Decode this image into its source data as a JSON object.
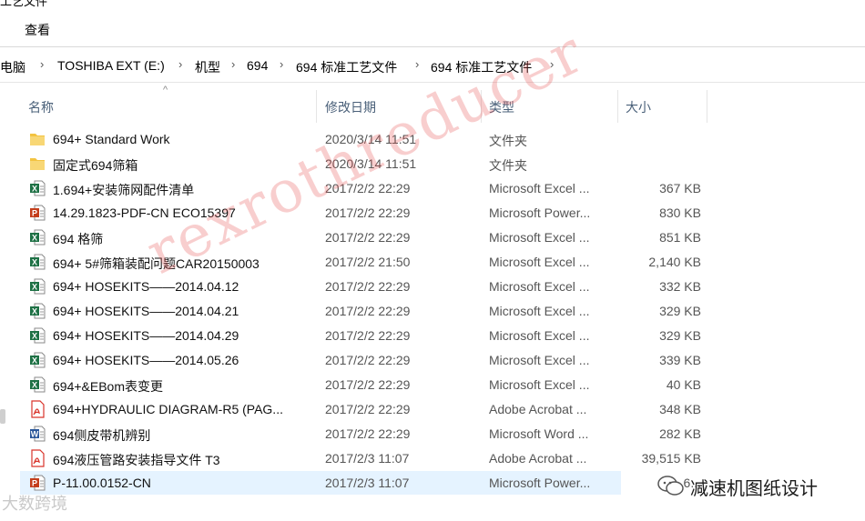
{
  "window": {
    "title_fragment": "工艺文件"
  },
  "ribbon": {
    "view_tab": "查看"
  },
  "address_bar": {
    "crumbs": [
      "此电脑",
      "TOSHIBA EXT (E:)",
      "机型",
      "694",
      "694 标准工艺文件",
      "694 标准工艺文件"
    ],
    "separator_icon": "chevron-right-icon"
  },
  "columns": {
    "name": "名称",
    "date": "修改日期",
    "type": "类型",
    "size": "大小"
  },
  "files": [
    {
      "name": "694+ Standard Work",
      "date": "2020/3/14 11:51",
      "type": "文件夹",
      "size": "",
      "icon": "folder-icon"
    },
    {
      "name": "固定式694筛箱",
      "date": "2020/3/14 11:51",
      "type": "文件夹",
      "size": "",
      "icon": "folder-icon"
    },
    {
      "name": "1.694+安装筛网配件清单",
      "date": "2017/2/2 22:29",
      "type": "Microsoft Excel ...",
      "size": "367 KB",
      "icon": "excel-icon"
    },
    {
      "name": "14.29.1823-PDF-CN ECO15397",
      "date": "2017/2/2 22:29",
      "type": "Microsoft Power...",
      "size": "830 KB",
      "icon": "powerpoint-icon"
    },
    {
      "name": "694 格筛",
      "date": "2017/2/2 22:29",
      "type": "Microsoft Excel ...",
      "size": "851 KB",
      "icon": "excel-icon"
    },
    {
      "name": "694+ 5#筛箱装配问题CAR20150003",
      "date": "2017/2/2 21:50",
      "type": "Microsoft Excel ...",
      "size": "2,140 KB",
      "icon": "excel-icon"
    },
    {
      "name": "694+ HOSEKITS——2014.04.12",
      "date": "2017/2/2 22:29",
      "type": "Microsoft Excel ...",
      "size": "332 KB",
      "icon": "excel-icon"
    },
    {
      "name": "694+ HOSEKITS——2014.04.21",
      "date": "2017/2/2 22:29",
      "type": "Microsoft Excel ...",
      "size": "329 KB",
      "icon": "excel-icon"
    },
    {
      "name": "694+ HOSEKITS——2014.04.29",
      "date": "2017/2/2 22:29",
      "type": "Microsoft Excel ...",
      "size": "329 KB",
      "icon": "excel-icon"
    },
    {
      "name": "694+ HOSEKITS——2014.05.26",
      "date": "2017/2/2 22:29",
      "type": "Microsoft Excel ...",
      "size": "339 KB",
      "icon": "excel-icon"
    },
    {
      "name": "694+&EBom表变更",
      "date": "2017/2/2 22:29",
      "type": "Microsoft Excel ...",
      "size": "40 KB",
      "icon": "excel-icon"
    },
    {
      "name": "694+HYDRAULIC DIAGRAM-R5 (PAG...",
      "date": "2017/2/2 22:29",
      "type": "Adobe Acrobat ...",
      "size": "348 KB",
      "icon": "pdf-icon"
    },
    {
      "name": "694侧皮带机辨别",
      "date": "2017/2/2 22:29",
      "type": "Microsoft Word ...",
      "size": "282 KB",
      "icon": "word-icon"
    },
    {
      "name": "694液压管路安装指导文件 T3",
      "date": "2017/2/3 11:07",
      "type": "Adobe Acrobat ...",
      "size": "39,515 KB",
      "icon": "pdf-icon"
    },
    {
      "name": "P-11.00.0152-CN",
      "date": "2017/2/3 11:07",
      "type": "Microsoft Power...",
      "size": "6...",
      "icon": "powerpoint-icon",
      "selected": true
    }
  ],
  "watermarks": {
    "diagonal": "rexrothreducer",
    "bottom_left": "大数跨境",
    "bottom_right": "减速机图纸设计"
  },
  "colors": {
    "excel": "#1e7145",
    "powerpoint": "#c43e1c",
    "word": "#2b579a",
    "pdf": "#d9342b",
    "folder": "#f3c341",
    "selection": "#e5f3ff"
  }
}
